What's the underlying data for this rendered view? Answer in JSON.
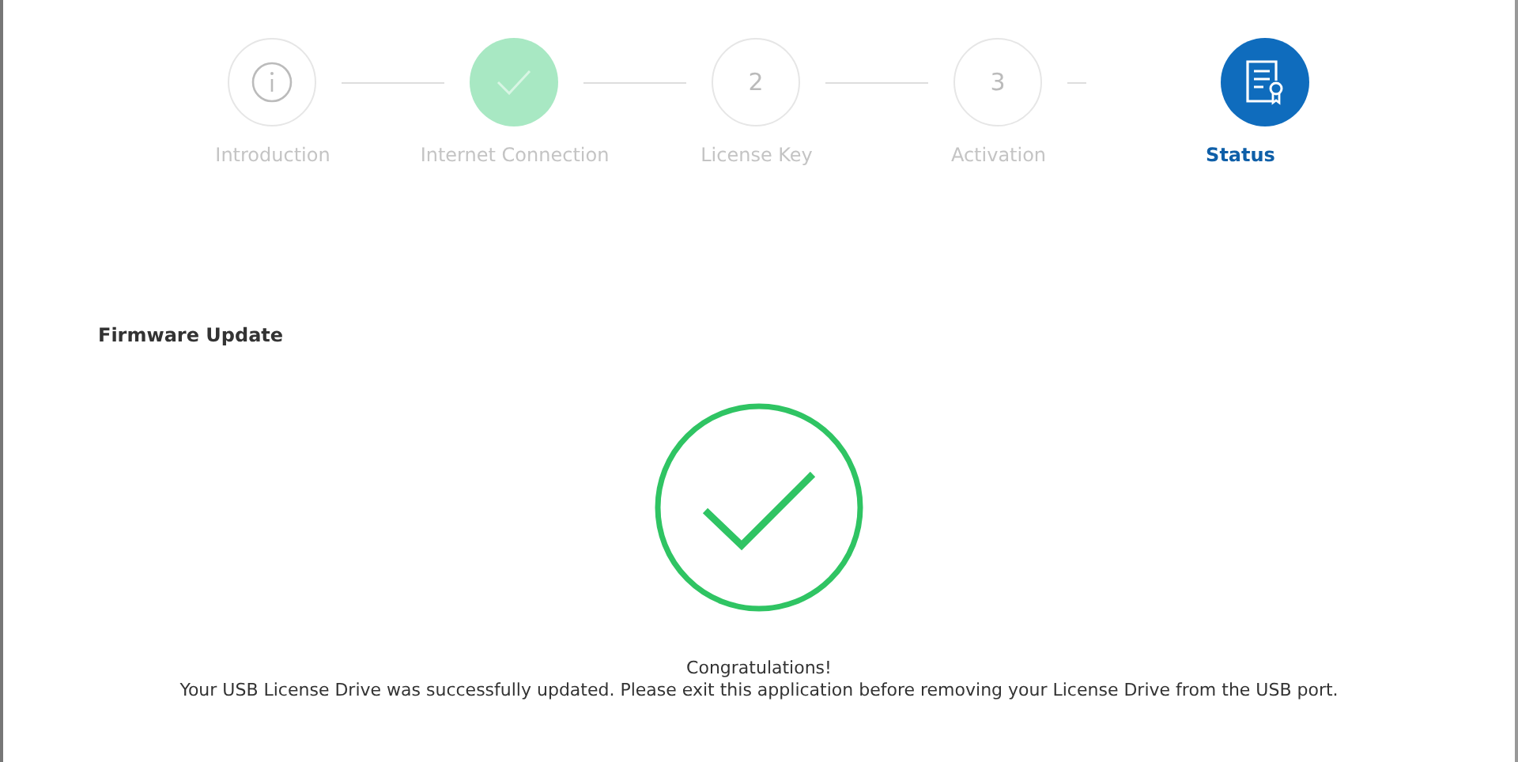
{
  "steps": [
    {
      "kind": "info",
      "label": "Introduction",
      "completed": false,
      "selected": false
    },
    {
      "kind": "check",
      "label": "Internet Connection",
      "completed": true,
      "selected": false
    },
    {
      "kind": "number",
      "number": "2",
      "label": "License Key",
      "completed": false,
      "selected": false
    },
    {
      "kind": "number",
      "number": "3",
      "label": "Activation",
      "completed": false,
      "selected": false
    },
    {
      "kind": "document",
      "label": "Status",
      "completed": false,
      "selected": true
    }
  ],
  "section_title": "Firmware Update",
  "result": {
    "success": true,
    "heading": "Congratulations!",
    "message": "Your USB License Drive was successfully updated. Please exit this application before removing your License Drive from the USB port."
  }
}
